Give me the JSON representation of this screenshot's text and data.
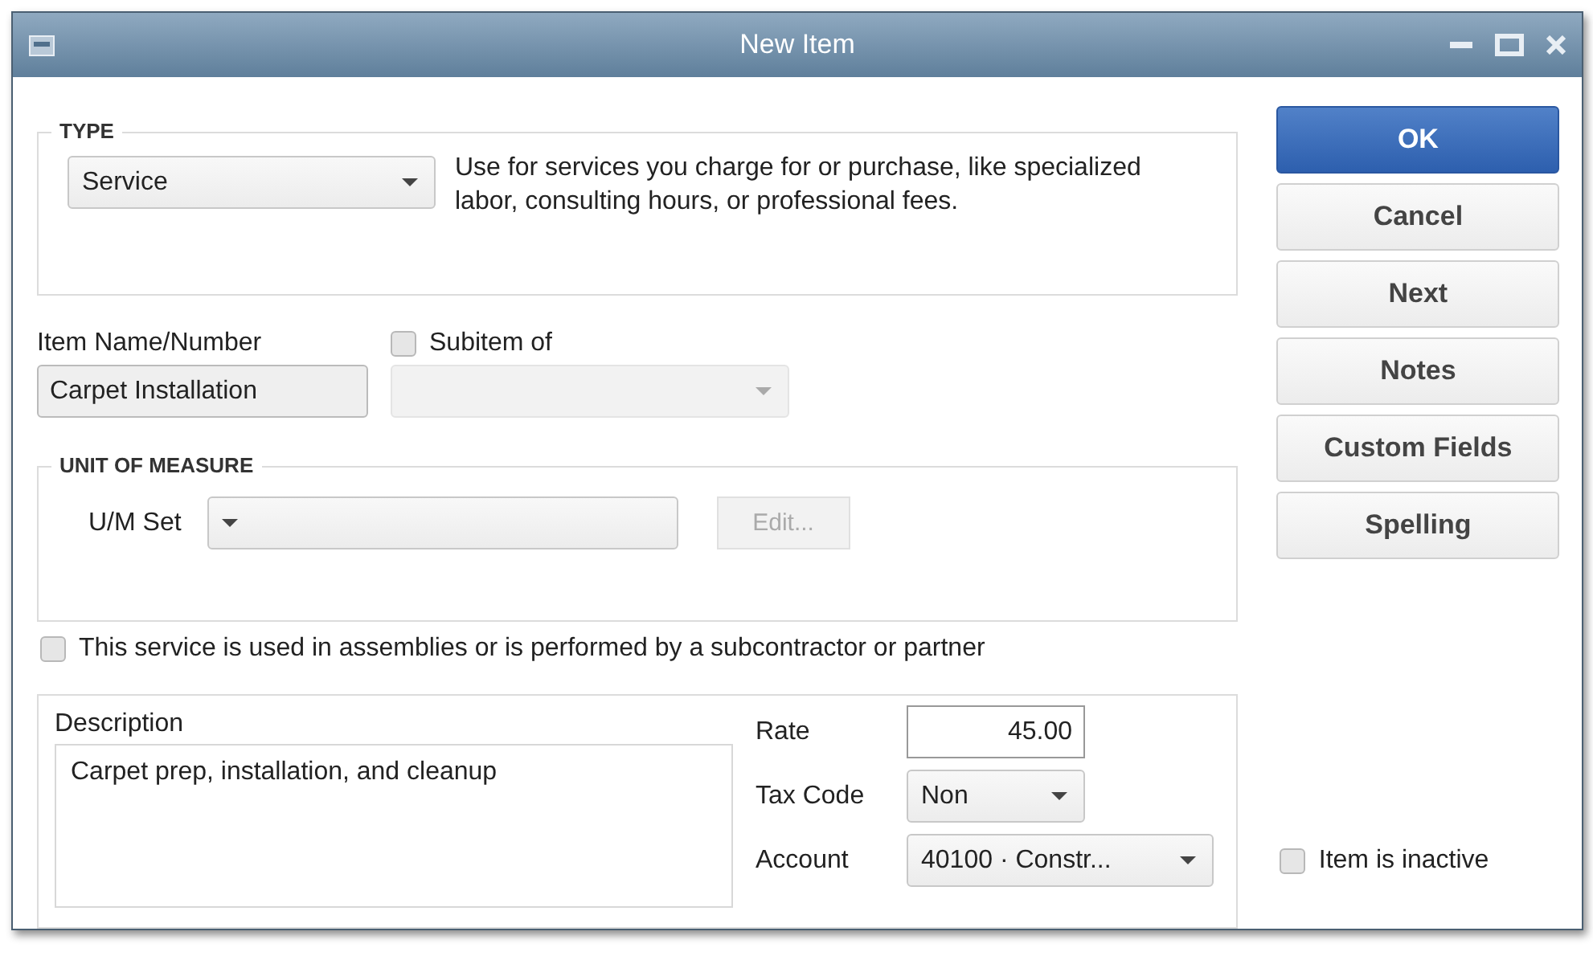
{
  "window": {
    "title": "New Item"
  },
  "type_group": {
    "heading": "TYPE",
    "type_select": {
      "value": "Service"
    },
    "hint": "Use for services you charge for or purchase, like specialized labor, consulting hours, or professional fees."
  },
  "item_name": {
    "label": "Item Name/Number",
    "value": "Carpet Installation"
  },
  "subitem": {
    "label": "Subitem of",
    "checked": false,
    "disabled": true
  },
  "unit_of_measure": {
    "heading": "UNIT OF MEASURE",
    "label": "U/M Set",
    "edit_button": {
      "label": "Edit...",
      "disabled": true
    }
  },
  "assembly_option": {
    "label": "This service is used in assemblies or is performed by a subcontractor or partner",
    "checked": false
  },
  "details": {
    "description_label": "Description",
    "description": "Carpet prep, installation, and cleanup",
    "rate": {
      "label": "Rate",
      "value": "45.00"
    },
    "tax_code": {
      "label": "Tax Code",
      "value": "Non"
    },
    "account": {
      "label": "Account",
      "value": "40100 · Constr..."
    }
  },
  "buttons": [
    {
      "label": "OK",
      "kind": "primary"
    },
    {
      "label": "Cancel",
      "kind": "normal"
    },
    {
      "label": "Next",
      "kind": "normal"
    },
    {
      "label": "Notes",
      "kind": "normal"
    },
    {
      "label": "Custom Fields",
      "kind": "normal"
    },
    {
      "label": "Spelling",
      "kind": "normal"
    }
  ],
  "inactive": {
    "label": "Item is inactive",
    "checked": false
  }
}
